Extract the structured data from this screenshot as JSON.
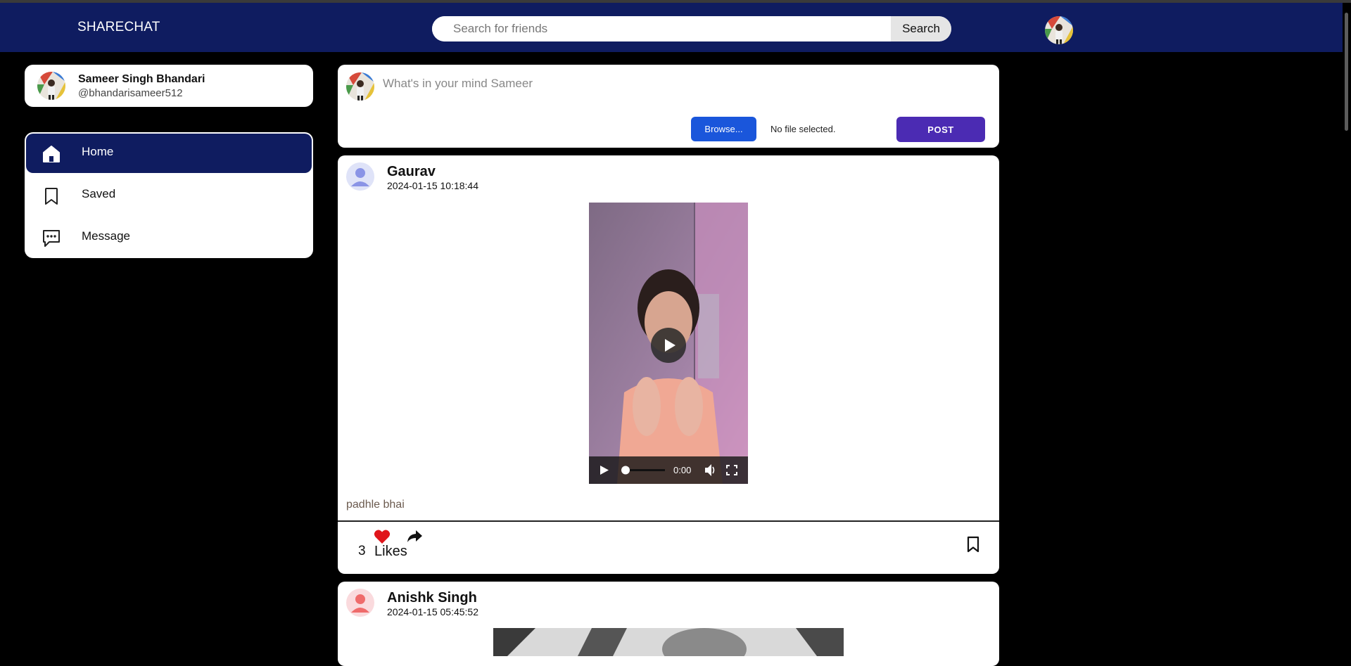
{
  "navbar": {
    "brand": "SHARECHAT",
    "search_placeholder": "Search for friends",
    "search_button": "Search"
  },
  "profile": {
    "name": "Sameer Singh Bhandari",
    "handle": "@bhandarisameer512"
  },
  "menu": {
    "items": [
      {
        "label": "Home",
        "icon": "home-icon",
        "active": true
      },
      {
        "label": "Saved",
        "icon": "bookmark-icon",
        "active": false
      },
      {
        "label": "Message",
        "icon": "message-icon",
        "active": false
      }
    ]
  },
  "composer": {
    "placeholder": "What's in your mind Sameer",
    "browse_label": "Browse...",
    "file_status": "No file selected.",
    "post_label": "POST"
  },
  "posts": [
    {
      "author": "Gaurav",
      "timestamp": "2024-01-15 10:18:44",
      "video_time": "0:00",
      "caption": "padhle bhai",
      "likes": "3",
      "likes_label": "Likes"
    },
    {
      "author": "Anishk Singh",
      "timestamp": "2024-01-15 05:45:52"
    }
  ],
  "colors": {
    "navbar": "#0f1c60",
    "active_menu": "#0f1c60",
    "browse_button": "#1a56db",
    "post_button": "#4b2bb3",
    "like_heart": "#e0161b"
  }
}
